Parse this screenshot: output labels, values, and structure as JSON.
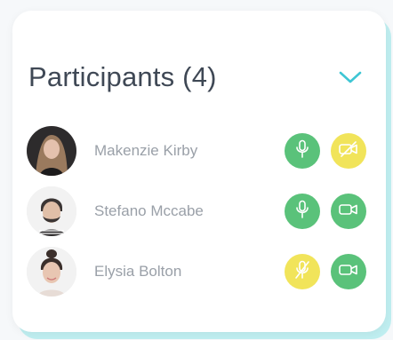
{
  "panel": {
    "title": "Participants (4)",
    "collapse_icon": "chevron-down-icon"
  },
  "colors": {
    "accent": "#3ec6d4",
    "enabled": "#5ac27a",
    "disabled": "#f1e45a",
    "title": "#3f4855",
    "name": "#9aa0a8"
  },
  "participants": [
    {
      "name": "Makenzie Kirby",
      "mic": "on",
      "camera": "off"
    },
    {
      "name": "Stefano Mccabe",
      "mic": "on",
      "camera": "on"
    },
    {
      "name": "Elysia Bolton",
      "mic": "off",
      "camera": "on"
    }
  ]
}
